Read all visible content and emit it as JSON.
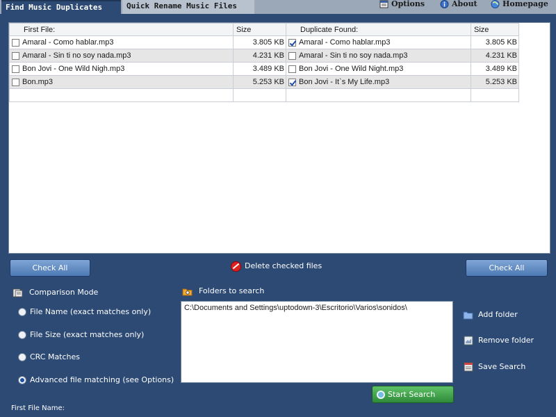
{
  "tabs": {
    "active": "Find Music Duplicates",
    "inactive": "Quick Rename Music Files"
  },
  "top_links": {
    "options": "Options",
    "about": "About",
    "homepage": "Homepage"
  },
  "table": {
    "headers": {
      "first_file": "First File:",
      "size1": "Size",
      "duplicate": "Duplicate Found:",
      "size2": "Size"
    },
    "rows": [
      {
        "file": "Amaral - Como hablar.mp3",
        "size": "3.805 KB",
        "checked1": false,
        "dup": "Amaral - Como hablar.mp3",
        "dup_size": "3.805 KB",
        "checked2": true
      },
      {
        "file": "Amaral - Sin ti no soy nada.mp3",
        "size": "4.231 KB",
        "checked1": false,
        "dup": "Amaral - Sin ti no soy nada.mp3",
        "dup_size": "4.231 KB",
        "checked2": false
      },
      {
        "file": "Bon Jovi - One Wild Nigh.mp3",
        "size": "3.489 KB",
        "checked1": false,
        "dup": "Bon Jovi - One Wild Night.mp3",
        "dup_size": "3.489 KB",
        "checked2": false
      },
      {
        "file": "Bon.mp3",
        "size": "5.253 KB",
        "checked1": false,
        "dup": "Bon Jovi - It`s My Life.mp3",
        "dup_size": "5.253 KB",
        "checked2": true
      }
    ]
  },
  "actions": {
    "check_all_left": "Check All",
    "delete_checked": "Delete checked files",
    "check_all_right": "Check All"
  },
  "comparison": {
    "title": "Comparison Mode",
    "options": [
      {
        "label": "File Name (exact matches only)",
        "selected": false
      },
      {
        "label": "File Size (exact matches only)",
        "selected": false
      },
      {
        "label": "CRC Matches",
        "selected": false
      },
      {
        "label": "Advanced file matching (see Options)",
        "selected": true
      }
    ]
  },
  "folders": {
    "title": "Folders to search",
    "path": "C:\\Documents and Settings\\uptodown-3\\Escritorio\\Varios\\sonidos\\",
    "add": "Add folder",
    "remove": "Remove folder",
    "save": "Save Search",
    "start": "Start Search"
  },
  "footer": {
    "first_file_name": "First File Name:"
  },
  "colors": {
    "background": "#2c4a74",
    "button": "#5a84bd",
    "start_button": "#3fa34a",
    "delete_icon": "#dd2222"
  }
}
